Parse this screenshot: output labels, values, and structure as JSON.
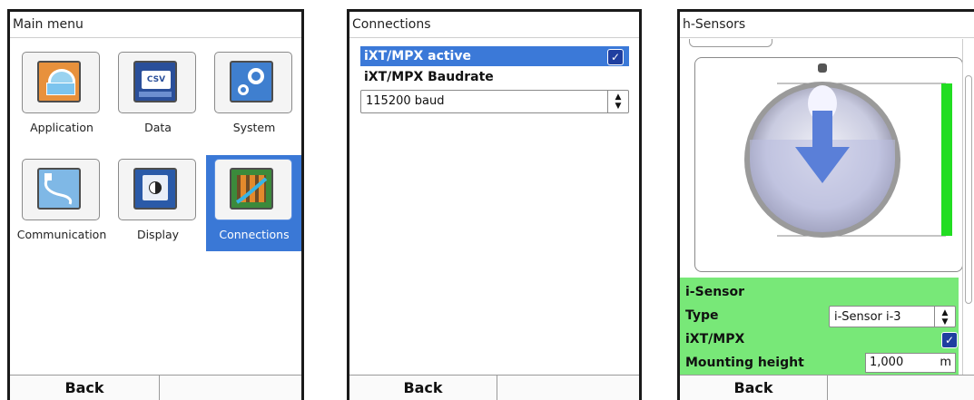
{
  "main_menu": {
    "title": "Main menu",
    "tiles": [
      {
        "label": "Application",
        "icon": "application-icon"
      },
      {
        "label": "Data",
        "icon": "data-icon"
      },
      {
        "label": "System",
        "icon": "system-gear-icon"
      },
      {
        "label": "Communication",
        "icon": "communication-icon"
      },
      {
        "label": "Display",
        "icon": "display-brightness-icon"
      },
      {
        "label": "Connections",
        "icon": "connections-icon",
        "selected": true
      }
    ],
    "data_icon_text": "CSV",
    "back_label": "Back"
  },
  "connections": {
    "title": "Connections",
    "active_label": "iXT/MPX active",
    "active_checked": true,
    "baudrate_label": "iXT/MPX Baudrate",
    "baudrate_value": "115200 baud",
    "back_label": "Back"
  },
  "sensors": {
    "title": "h-Sensors",
    "section_label": "i-Sensor",
    "type_label": "Type",
    "type_value": "i-Sensor i-3",
    "ixt_label": "iXT/MPX",
    "ixt_checked": true,
    "mounting_label": "Mounting height",
    "mounting_value": "1,000",
    "mounting_unit": "m",
    "back_label": "Back"
  },
  "colors": {
    "selection_blue": "#3b79d8",
    "panel_green": "#78e878",
    "level_bar_green": "#22dd22"
  }
}
